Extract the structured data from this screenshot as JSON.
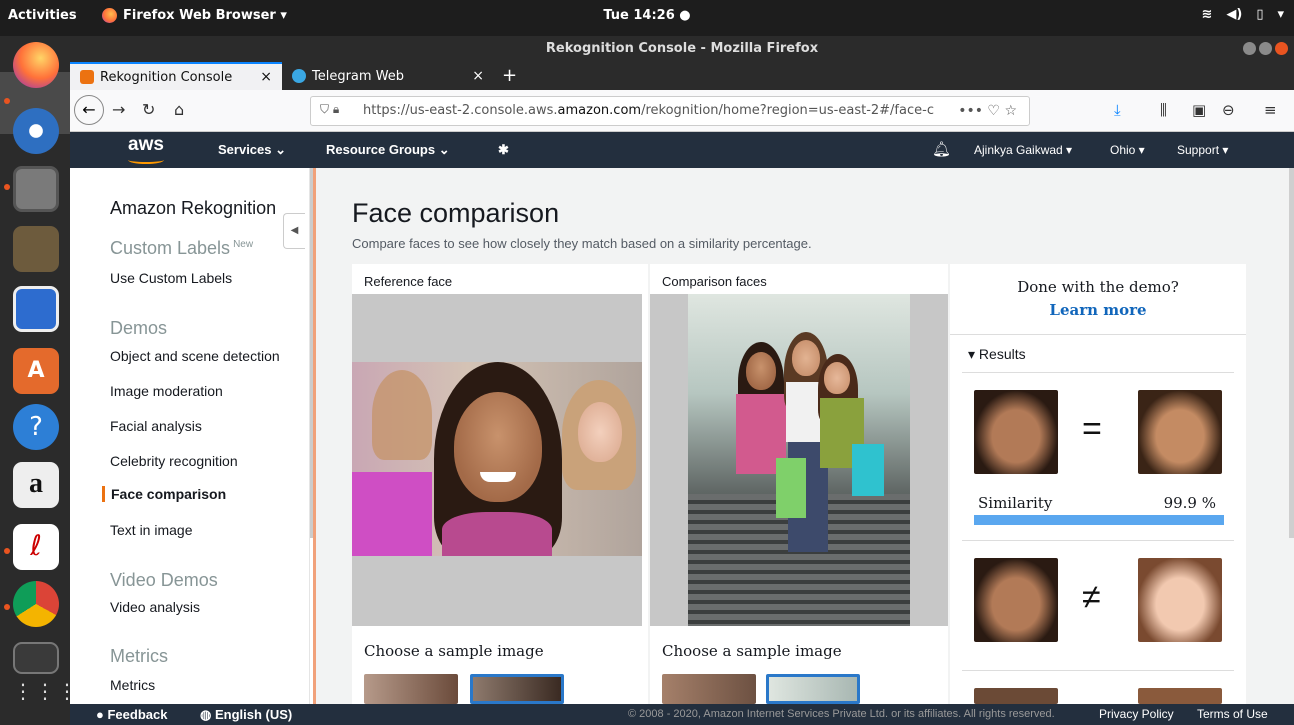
{
  "system": {
    "activities": "Activities",
    "app_name": "Firefox Web Browser ▾",
    "clock": "Tue 14:26 ●",
    "tray": [
      "wifi-icon",
      "volume-icon",
      "battery-icon",
      "menu-arrow-icon"
    ]
  },
  "browser": {
    "window_title": "Rekognition Console - Mozilla Firefox",
    "tabs": [
      {
        "label": "Rekognition Console",
        "active": true
      },
      {
        "label": "Telegram Web",
        "active": false
      }
    ],
    "url_prefix": "https://us-east-2.console.aws.",
    "url_domain": "amazon.com",
    "url_suffix": "/rekognition/home?region=us-east-2#/face-c"
  },
  "aws_header": {
    "logo": "aws",
    "services": "Services ⌄",
    "resource_groups": "Resource Groups ⌄",
    "user": "Ajinkya Gaikwad ▾",
    "region": "Ohio ▾",
    "support": "Support ▾"
  },
  "sidebar": {
    "title": "Amazon Rekognition",
    "custom_labels_heading": "Custom Labels",
    "new_badge": "New",
    "use_custom_labels": "Use Custom Labels",
    "demos_heading": "Demos",
    "demos": [
      "Object and scene detection",
      "Image moderation",
      "Facial analysis",
      "Celebrity recognition",
      "Face comparison",
      "Text in image"
    ],
    "video_heading": "Video Demos",
    "video_analysis": "Video analysis",
    "metrics_heading": "Metrics",
    "metrics": "Metrics"
  },
  "main": {
    "title": "Face comparison",
    "subtitle": "Compare faces to see how closely they match based on a similarity percentage.",
    "reference_label": "Reference face",
    "comparison_label": "Comparison faces",
    "choose_sample": "Choose a sample image"
  },
  "results_panel": {
    "done_text": "Done with the demo?",
    "learn_more": "Learn more",
    "results_heading": "Results",
    "match_symbol": "=",
    "nomatch_symbol": "≠",
    "similarity_label": "Similarity",
    "similarity_value": "99.9 %",
    "similarity_fraction": 0.999
  },
  "footer": {
    "feedback": "Feedback",
    "language": "English (US)",
    "copyright": "© 2008 - 2020, Amazon Internet Services Private Ltd. or its affiliates. All rights reserved.",
    "privacy": "Privacy Policy",
    "terms": "Terms of Use"
  },
  "colors": {
    "aws_dark": "#232f3e",
    "aws_orange": "#ec7211",
    "link_blue": "#1166bb",
    "similarity_bar": "#5aa7ef"
  }
}
